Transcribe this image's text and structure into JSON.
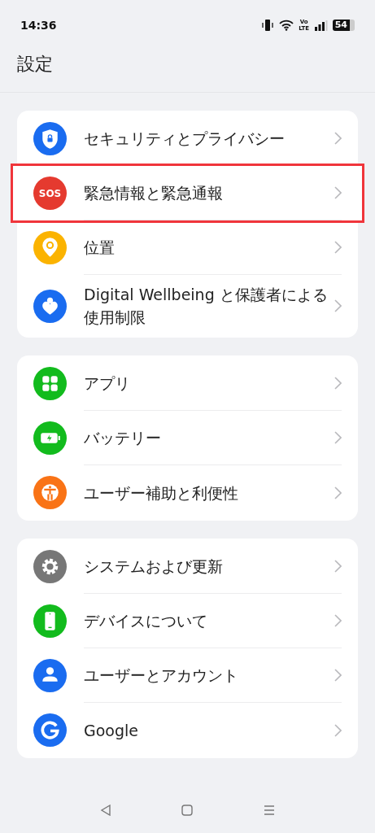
{
  "status_bar": {
    "time": "14:36",
    "network": "Vo LTE",
    "battery": "54"
  },
  "title": "設定",
  "groups": [
    {
      "items": [
        {
          "kind": "shield",
          "label": "セキュリティとプライバシー",
          "color": "#1a6cf0",
          "highlighted": false
        },
        {
          "kind": "sos",
          "label": "緊急情報と緊急通報",
          "color": "#e53a2f",
          "badge": "SOS",
          "highlighted": true
        },
        {
          "kind": "location",
          "label": "位置",
          "color": "#fbb300",
          "highlighted": false
        },
        {
          "kind": "wellbeing",
          "label": "Digital Wellbeing と保護者による使用制限",
          "color": "#1a6cf0",
          "highlighted": false
        }
      ]
    },
    {
      "items": [
        {
          "kind": "apps",
          "label": "アプリ",
          "color": "#12bb1d",
          "highlighted": false
        },
        {
          "kind": "battery",
          "label": "バッテリー",
          "color": "#12bb1d",
          "highlighted": false
        },
        {
          "kind": "accessibility",
          "label": "ユーザー補助と利便性",
          "color": "#f97316",
          "highlighted": false
        }
      ]
    },
    {
      "items": [
        {
          "kind": "gear",
          "label": "システムおよび更新",
          "color": "#777777",
          "highlighted": false
        },
        {
          "kind": "phone",
          "label": "デバイスについて",
          "color": "#12bb1d",
          "highlighted": false
        },
        {
          "kind": "person",
          "label": "ユーザーとアカウント",
          "color": "#1a6cf0",
          "highlighted": false
        },
        {
          "kind": "google",
          "label": "Google",
          "color": "#1a6cf0",
          "highlighted": false
        }
      ]
    }
  ]
}
